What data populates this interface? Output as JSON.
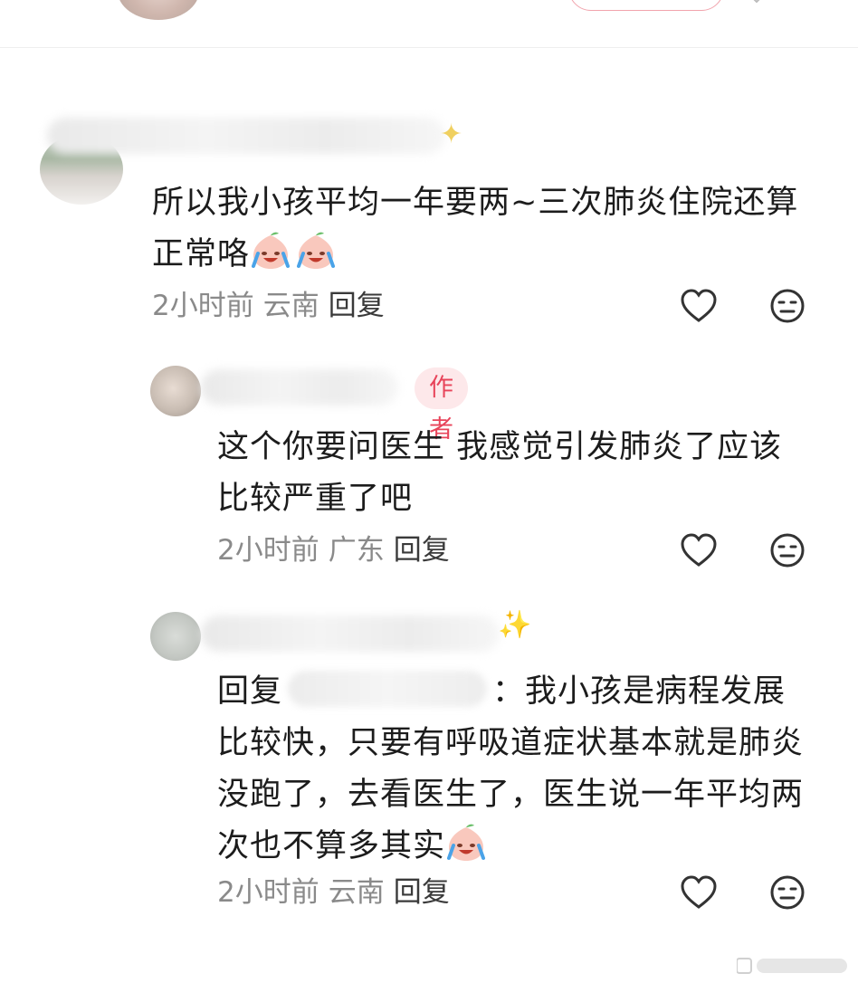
{
  "top": {
    "avatar_icon": "user-avatar",
    "more_icon": "chevron-icon"
  },
  "comments": [
    {
      "text": "所以我小孩平均一年要两~三次肺炎住院还算正常咯",
      "time": "2小时前",
      "location": "云南",
      "reply_label": "回复",
      "emojis": [
        "crying-laughing-peach",
        "crying-laughing-peach"
      ]
    },
    {
      "author_badge": "作者",
      "text": "这个你要问医生 我感觉引发肺炎了应该比较严重了吧",
      "time": "2小时前",
      "location": "广东",
      "reply_label": "回复"
    },
    {
      "reply_prefix": "回复",
      "reply_colon": "：",
      "text": "我小孩是病程发展比较快，只要有呼吸道症状基本就是肺炎没跑了，去看医生了，医生说一年平均两次也不算多其实",
      "time": "2小时前",
      "location": "云南",
      "reply_label": "回复",
      "emojis": [
        "crying-laughing-peach"
      ]
    }
  ],
  "icons": {
    "like": "heart-outline-icon",
    "dislike": "neutral-face-icon",
    "sparkle": "sparkles-icon"
  },
  "colors": {
    "badge_bg": "#fde8ea",
    "badge_text": "#e8445a",
    "meta_text": "#8a8a8a"
  }
}
